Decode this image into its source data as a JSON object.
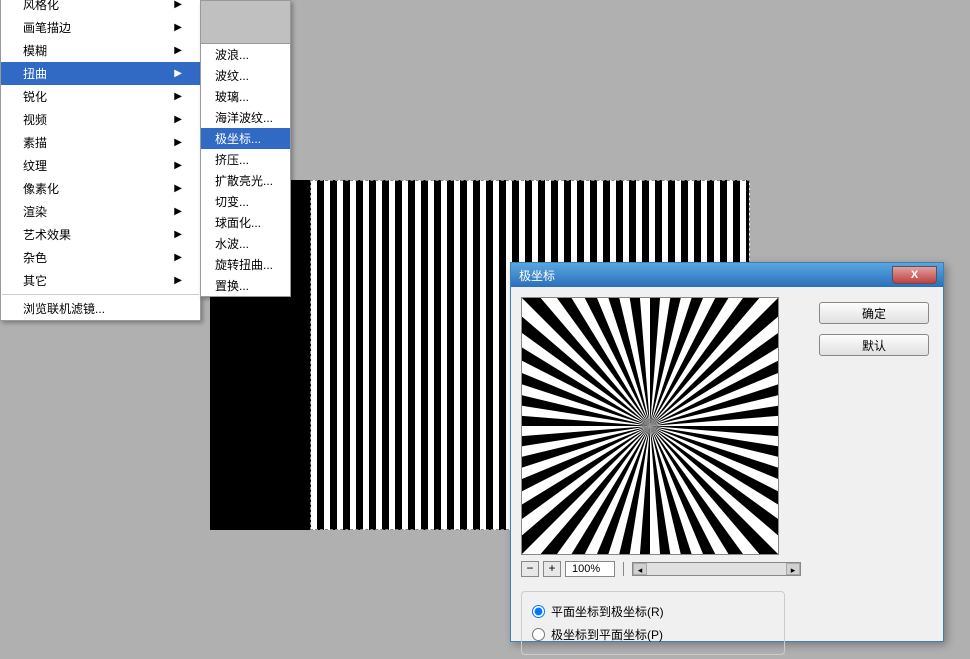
{
  "menu1": {
    "items": [
      {
        "label": "风格化",
        "arrow": true,
        "cut": true
      },
      {
        "label": "画笔描边",
        "arrow": true
      },
      {
        "label": "模糊",
        "arrow": true
      },
      {
        "label": "扭曲",
        "arrow": true,
        "highlighted": true
      },
      {
        "label": "锐化",
        "arrow": true
      },
      {
        "label": "视频",
        "arrow": true
      },
      {
        "label": "素描",
        "arrow": true
      },
      {
        "label": "纹理",
        "arrow": true
      },
      {
        "label": "像素化",
        "arrow": true
      },
      {
        "label": "渲染",
        "arrow": true
      },
      {
        "label": "艺术效果",
        "arrow": true
      },
      {
        "label": "杂色",
        "arrow": true
      },
      {
        "label": "其它",
        "arrow": true
      }
    ],
    "browse": "浏览联机滤镜..."
  },
  "menu2": {
    "items": [
      {
        "label": "波浪..."
      },
      {
        "label": "波纹..."
      },
      {
        "label": "玻璃..."
      },
      {
        "label": "海洋波纹..."
      },
      {
        "label": "极坐标...",
        "highlighted": true
      },
      {
        "label": "挤压..."
      },
      {
        "label": "扩散亮光..."
      },
      {
        "label": "切变..."
      },
      {
        "label": "球面化..."
      },
      {
        "label": "水波..."
      },
      {
        "label": "旋转扭曲..."
      },
      {
        "label": "置换..."
      }
    ]
  },
  "dialog": {
    "title": "极坐标",
    "close": "X",
    "zoom_minus": "−",
    "zoom_plus": "+",
    "zoom_value": "100%",
    "scroll_left": "◂",
    "scroll_right": "▸",
    "option1": "平面坐标到极坐标(R)",
    "option2": "极坐标到平面坐标(P)",
    "ok": "确定",
    "default": "默认"
  }
}
